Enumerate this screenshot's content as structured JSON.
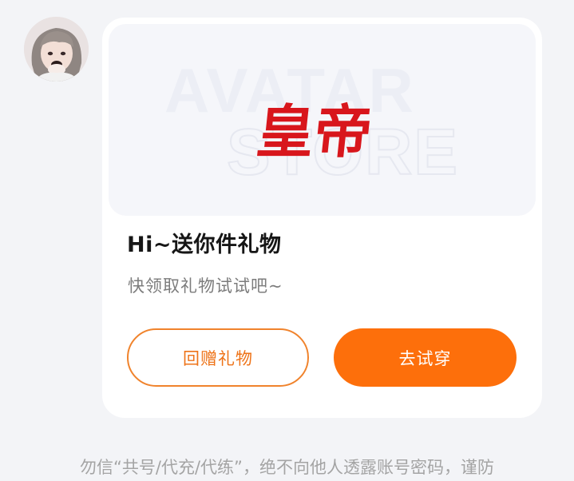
{
  "sender": {
    "avatar_alt": "avatar"
  },
  "gift_card": {
    "banner": {
      "watermark_line1": "AVATAR",
      "watermark_line2": "STORE",
      "gift_name": "皇帝",
      "gift_color": "#d8161c"
    },
    "title": "Hi~送你件礼物",
    "subtitle": "快领取礼物试试吧~",
    "return_gift_label": "回赠礼物",
    "try_on_label": "去试穿",
    "accent_color": "#fd6f0b"
  },
  "footer": {
    "warning": "勿信“共号/代充/代练”，绝不向他人透露账号密码，谨防"
  }
}
